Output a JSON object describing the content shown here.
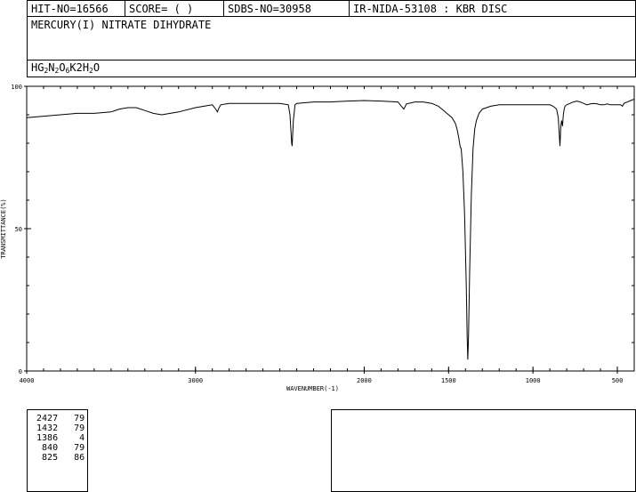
{
  "header": {
    "hit_no": "HIT-NO=16566",
    "score": "SCORE=  (   )",
    "sdbs_no": "SDBS-NO=30958",
    "method": "IR-NIDA-53108 : KBR DISC"
  },
  "compound_name": "MERCURY(I) NITRATE DIHYDRATE",
  "formula": {
    "parts": [
      {
        "t": "HG"
      },
      {
        "t": "2",
        "sub": true
      },
      {
        "t": "N"
      },
      {
        "t": "2",
        "sub": true
      },
      {
        "t": "O"
      },
      {
        "t": "6",
        "sub": true
      },
      {
        "t": "K2H"
      },
      {
        "t": "2",
        "sub": true
      },
      {
        "t": "O"
      }
    ]
  },
  "peak_table": [
    {
      "wavenumber": 2427,
      "transmittance": 79
    },
    {
      "wavenumber": 1432,
      "transmittance": 79
    },
    {
      "wavenumber": 1386,
      "transmittance": 4
    },
    {
      "wavenumber": 840,
      "transmittance": 79
    },
    {
      "wavenumber": 825,
      "transmittance": 86
    }
  ],
  "chart_data": {
    "type": "line",
    "xlabel": "WAVENUMBER(-1)",
    "ylabel": "TRANSMITTANCE(%)",
    "xlim": [
      4000,
      400
    ],
    "ylim": [
      0,
      100
    ],
    "x_ticks": [
      4000,
      3000,
      2000,
      1500,
      1000,
      500
    ],
    "x_tick_labels": [
      "4000",
      "3000",
      "2000",
      "1500",
      "1000",
      "500"
    ],
    "y_ticks": [
      0,
      50,
      100
    ],
    "y_tick_labels": [
      "0",
      "50",
      "100"
    ],
    "grid": false,
    "series": [
      {
        "x": [
          4000,
          3900,
          3800,
          3700,
          3600,
          3500,
          3450,
          3400,
          3350,
          3300,
          3250,
          3200,
          3100,
          3000,
          2950,
          2900,
          2880,
          2870,
          2860,
          2850,
          2800,
          2700,
          2600,
          2500,
          2450,
          2440,
          2430,
          2427,
          2420,
          2410,
          2400,
          2300,
          2200,
          2100,
          2000,
          1900,
          1800,
          1780,
          1765,
          1750,
          1700,
          1650,
          1600,
          1560,
          1520,
          1500,
          1480,
          1460,
          1450,
          1440,
          1432,
          1425,
          1415,
          1405,
          1395,
          1390,
          1386,
          1382,
          1375,
          1365,
          1355,
          1345,
          1335,
          1320,
          1300,
          1250,
          1200,
          1150,
          1100,
          1050,
          1000,
          950,
          900,
          880,
          860,
          850,
          845,
          840,
          835,
          830,
          825,
          820,
          815,
          810,
          800,
          780,
          760,
          740,
          720,
          700,
          680,
          660,
          640,
          620,
          600,
          580,
          560,
          540,
          520,
          500,
          480,
          470,
          460,
          440,
          420,
          400
        ],
        "y": [
          89,
          89.5,
          90,
          90.5,
          90.5,
          91,
          92,
          92.5,
          92.5,
          91.5,
          90.5,
          90,
          91,
          92.5,
          93,
          93.5,
          92,
          91,
          92.5,
          93.5,
          94,
          94,
          94,
          94,
          93.5,
          90,
          80,
          79,
          88,
          93.5,
          94,
          94.5,
          94.5,
          94.8,
          95,
          94.8,
          94.5,
          93,
          92,
          93.8,
          94.5,
          94.5,
          94,
          93,
          91,
          90,
          89,
          87,
          85,
          82,
          79,
          78,
          70,
          55,
          30,
          12,
          4,
          12,
          35,
          62,
          78,
          85,
          88,
          90.5,
          92,
          93,
          93.5,
          93.5,
          93.5,
          93.5,
          93.5,
          93.5,
          93.5,
          93,
          92,
          89,
          84,
          79,
          86,
          88,
          86,
          90,
          92,
          93,
          93.5,
          94,
          94.5,
          94.8,
          94.5,
          94,
          93.5,
          93.8,
          94,
          93.8,
          93.5,
          93.5,
          93.8,
          93.5,
          93.5,
          93.5,
          93.5,
          93,
          94,
          94.5,
          95,
          95.5
        ]
      }
    ]
  }
}
